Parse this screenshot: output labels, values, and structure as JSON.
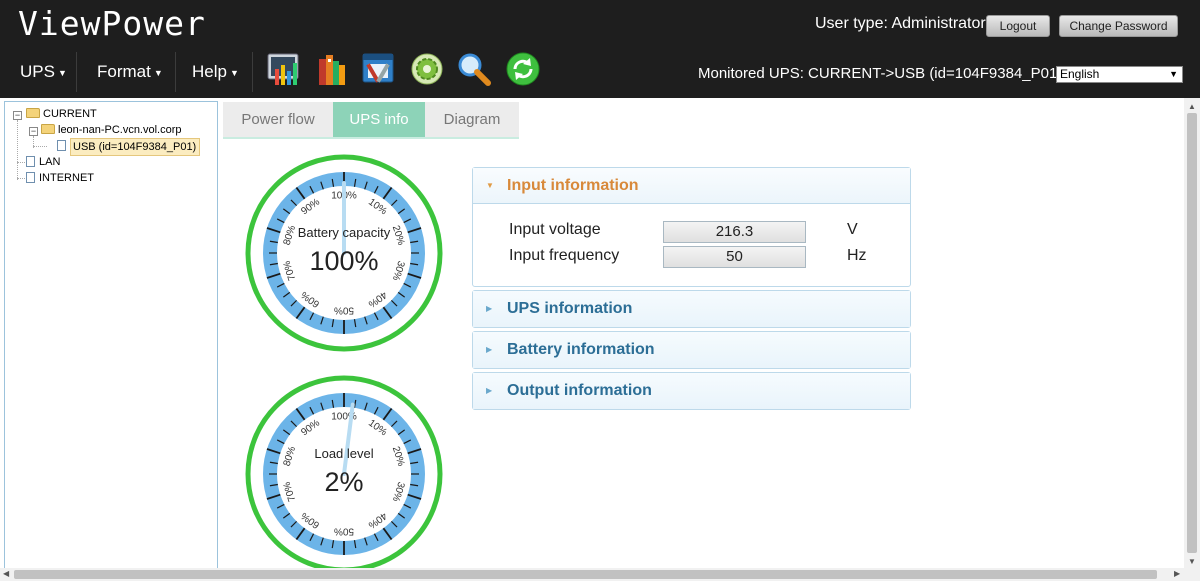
{
  "header": {
    "app_title": "ViewPower",
    "user_type": "User type: Administrator",
    "logout_label": "Logout",
    "change_password_label": "Change Password",
    "monitored": "Monitored UPS: CURRENT->USB (id=104F9384_P01)",
    "language": "English"
  },
  "menu": [
    {
      "label": "UPS"
    },
    {
      "label": "Format"
    },
    {
      "label": "Help"
    }
  ],
  "toolbar_icons": [
    "chart-icon",
    "books-icon",
    "tools-icon",
    "settings-icon",
    "search-icon",
    "refresh-icon"
  ],
  "tree": {
    "current": "CURRENT",
    "host": "leon-nan-PC.vcn.vol.corp",
    "usb": "USB (id=104F9384_P01)",
    "lan": "LAN",
    "internet": "INTERNET"
  },
  "tabs": [
    "Power flow",
    "UPS info",
    "Diagram"
  ],
  "active_tab": "UPS info",
  "gauges": {
    "battery": {
      "label": "Battery capacity",
      "value_text": "100%",
      "percent": 100
    },
    "load": {
      "label": "Load level",
      "value_text": "2%",
      "percent": 2
    },
    "tick_labels": [
      "100%",
      "10%",
      "20%",
      "30%",
      "40%",
      "50%",
      "60%",
      "70%",
      "80%",
      "90%"
    ]
  },
  "panels": {
    "input": {
      "title": "Input information",
      "rows": [
        {
          "label": "Input voltage",
          "value": "216.3",
          "unit": "V"
        },
        {
          "label": "Input frequency",
          "value": "50",
          "unit": "Hz"
        }
      ]
    },
    "ups": {
      "title": "UPS information"
    },
    "battery": {
      "title": "Battery information"
    },
    "output": {
      "title": "Output information"
    }
  },
  "colors": {
    "header_bg": "#1e1e1e",
    "tab_active": "#8dd3b8",
    "gauge_ring": "#3cc43c",
    "gauge_band": "#6cb4e8",
    "panel_title_active": "#d8893a",
    "panel_title": "#2c6e96"
  }
}
